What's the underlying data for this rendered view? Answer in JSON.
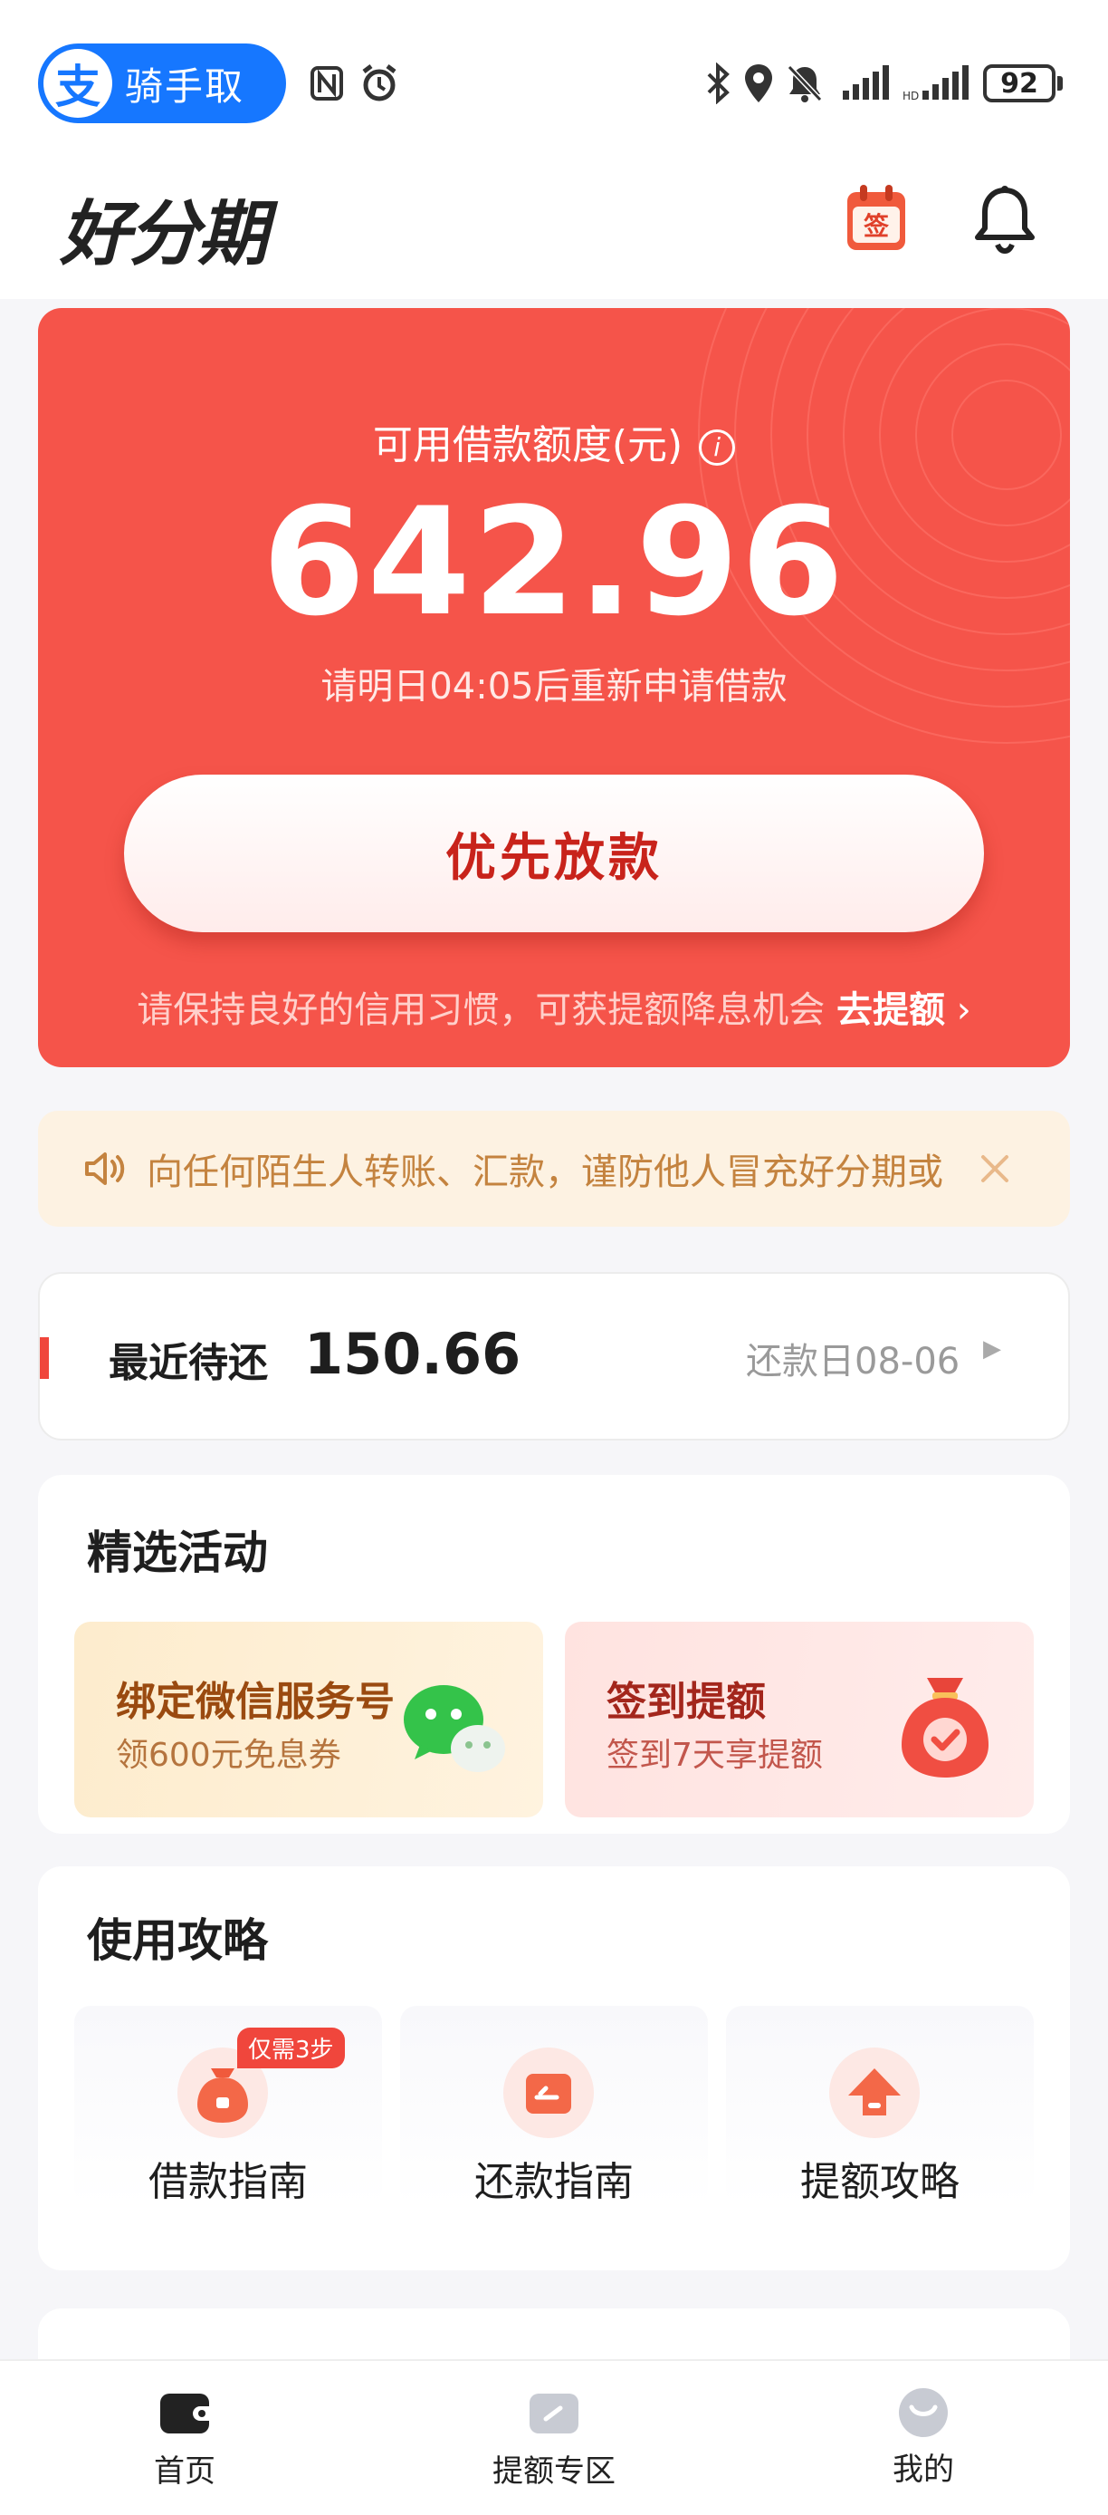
{
  "status_bar": {
    "app_pill": "骑手取",
    "battery": "92"
  },
  "header": {
    "logo": "好分期",
    "calendar_icon_text": "签"
  },
  "credit": {
    "label": "可用借款额度(元)",
    "amount": "642.96",
    "note": "请明日04:05后重新申请借款",
    "button": "优先放款",
    "tip": "请保持良好的信用习惯，可获提额降息机会",
    "tip_link": "去提额"
  },
  "notice": {
    "text": "向任何陌生人转账、汇款，谨防他人冒充好分期或"
  },
  "repay": {
    "label": "最近待还",
    "amount": "150.66",
    "due": "还款日08-06"
  },
  "activities": {
    "title": "精选活动",
    "items": [
      {
        "title": "绑定微信服务号",
        "subtitle": "领600元免息券"
      },
      {
        "title": "签到提额",
        "subtitle": "签到7天享提额"
      }
    ]
  },
  "guides": {
    "title": "使用攻略",
    "badge": "仅需3步",
    "items": [
      {
        "label": "借款指南"
      },
      {
        "label": "还款指南"
      },
      {
        "label": "提额攻略"
      }
    ]
  },
  "nav": {
    "items": [
      {
        "label": "首页"
      },
      {
        "label": "提额专区"
      },
      {
        "label": "我的"
      }
    ]
  },
  "colors": {
    "brand_red": "#f5544a",
    "button_text": "#c8231b",
    "notice_bg": "#fdf2e2"
  }
}
